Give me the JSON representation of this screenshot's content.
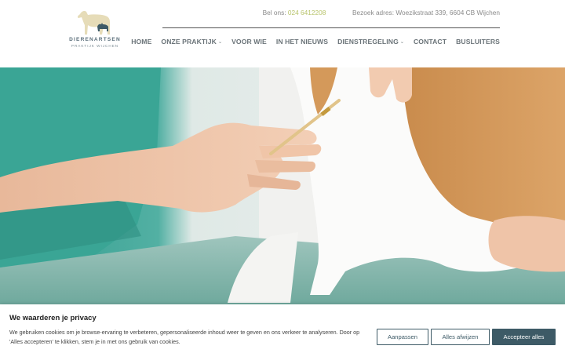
{
  "site": {
    "logo_title": "DIERENARTSEN",
    "logo_subtitle": "PRAKTIJK WIJCHEN"
  },
  "topbar": {
    "phone_label": "Bel ons:",
    "phone_number": "024 6412208",
    "address_label": "Bezoek adres:",
    "address": "Woezikstraat 339, 6604 CB Wijchen"
  },
  "nav": {
    "items": [
      {
        "label": "HOME",
        "dropdown": false
      },
      {
        "label": "ONZE PRAKTIJK",
        "dropdown": true
      },
      {
        "label": "VOOR WIE",
        "dropdown": false
      },
      {
        "label": "IN HET NIEUWS",
        "dropdown": false
      },
      {
        "label": "DIENSTREGELING",
        "dropdown": true
      },
      {
        "label": "CONTACT",
        "dropdown": false
      },
      {
        "label": "BUSLUITERS",
        "dropdown": false
      }
    ]
  },
  "cookie": {
    "title": "We waarderen je privacy",
    "text": "We gebruiken cookies om je browse-ervaring te verbeteren, gepersonaliseerde inhoud weer te geven en ons verkeer te analyseren. Door op 'Alles accepteren' te klikken, stem je in met ons gebruik van cookies.",
    "customize_label": "Aanpassen",
    "reject_label": "Alles afwijzen",
    "accept_label": "Accepteer alles"
  },
  "colors": {
    "accent": "#b7c36a",
    "button": "#3d5a66",
    "nav_text": "#6a7378"
  }
}
